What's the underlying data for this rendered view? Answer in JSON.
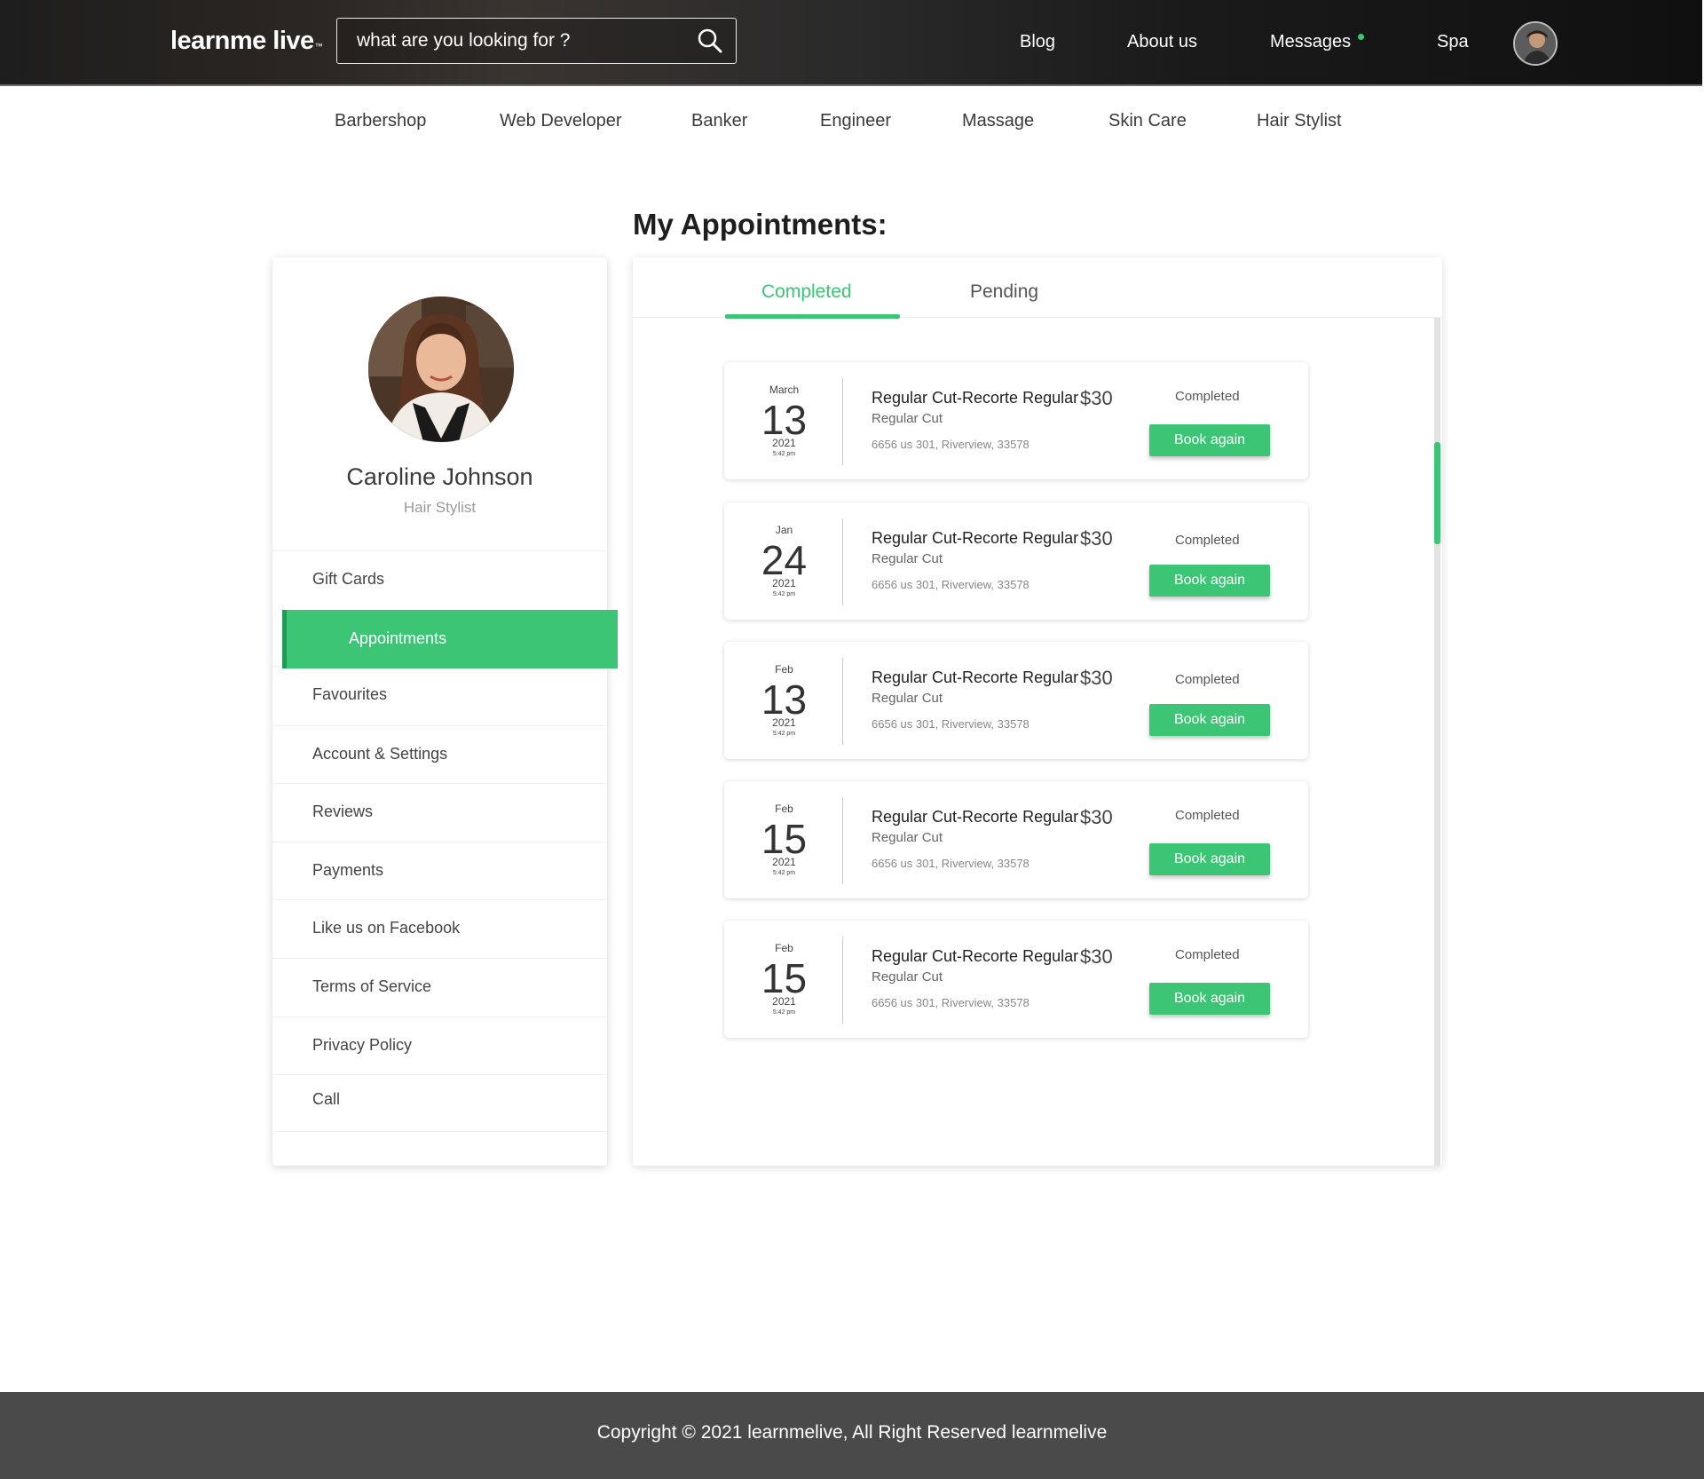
{
  "header": {
    "logo_main": "learnme live",
    "logo_tm": "™",
    "search_placeholder": "what are you looking for ?",
    "nav": [
      {
        "label": "Blog"
      },
      {
        "label": "About us"
      },
      {
        "label": "Messages"
      },
      {
        "label": "Spa"
      }
    ]
  },
  "categories": [
    {
      "label": "Barbershop"
    },
    {
      "label": "Web Developer"
    },
    {
      "label": "Banker"
    },
    {
      "label": "Engineer"
    },
    {
      "label": "Massage"
    },
    {
      "label": "Skin Care"
    },
    {
      "label": "Hair Stylist"
    }
  ],
  "page_title": "My Appointments:",
  "profile": {
    "name": "Caroline Johnson",
    "role": "Hair Stylist"
  },
  "menu": [
    {
      "label": "Gift Cards"
    },
    {
      "label": "Appointments"
    },
    {
      "label": "Favourites"
    },
    {
      "label": "Account & Settings"
    },
    {
      "label": "Reviews"
    },
    {
      "label": "Payments"
    },
    {
      "label": "Like us on Facebook"
    },
    {
      "label": "Terms of Service"
    },
    {
      "label": "Privacy Policy"
    },
    {
      "label": "Call"
    }
  ],
  "tabs": [
    {
      "label": "Completed",
      "active": true
    },
    {
      "label": "Pending",
      "active": false
    }
  ],
  "appointments": [
    {
      "month": "March",
      "day": "13",
      "year": "2021",
      "time": "5:42 pm",
      "service": "Regular Cut-Recorte Regular",
      "price": "$30",
      "subtitle": "Regular Cut",
      "address": "6656 us 301, Riverview, 33578",
      "status": "Completed",
      "action": "Book again"
    },
    {
      "month": "Jan",
      "day": "24",
      "year": "2021",
      "time": "5:42 pm",
      "service": "Regular Cut-Recorte Regular",
      "price": "$30",
      "subtitle": "Regular Cut",
      "address": "6656 us 301, Riverview, 33578",
      "status": "Completed",
      "action": "Book again"
    },
    {
      "month": "Feb",
      "day": "13",
      "year": "2021",
      "time": "5:42 pm",
      "service": "Regular Cut-Recorte Regular",
      "price": "$30",
      "subtitle": "Regular Cut",
      "address": "6656 us 301, Riverview, 33578",
      "status": "Completed",
      "action": "Book again"
    },
    {
      "month": "Feb",
      "day": "15",
      "year": "2021",
      "time": "5:42 pm",
      "service": "Regular Cut-Recorte Regular",
      "price": "$30",
      "subtitle": "Regular Cut",
      "address": "6656 us 301, Riverview, 33578",
      "status": "Completed",
      "action": "Book again"
    },
    {
      "month": "Feb",
      "day": "15",
      "year": "2021",
      "time": "5:42 pm",
      "service": "Regular Cut-Recorte Regular",
      "price": "$30",
      "subtitle": "Regular Cut",
      "address": "6656 us 301, Riverview, 33578",
      "status": "Completed",
      "action": "Book again"
    }
  ],
  "footer": {
    "text": "Copyright © 2021 learnmelive, All Right Reserved learnmelive"
  },
  "colors": {
    "accent": "#3cc575",
    "accent_dark": "#1f9b53",
    "footer_bg": "#4a4a4a"
  },
  "icons": {
    "search": "search-icon",
    "messages_indicator": "notification-dot-icon"
  }
}
